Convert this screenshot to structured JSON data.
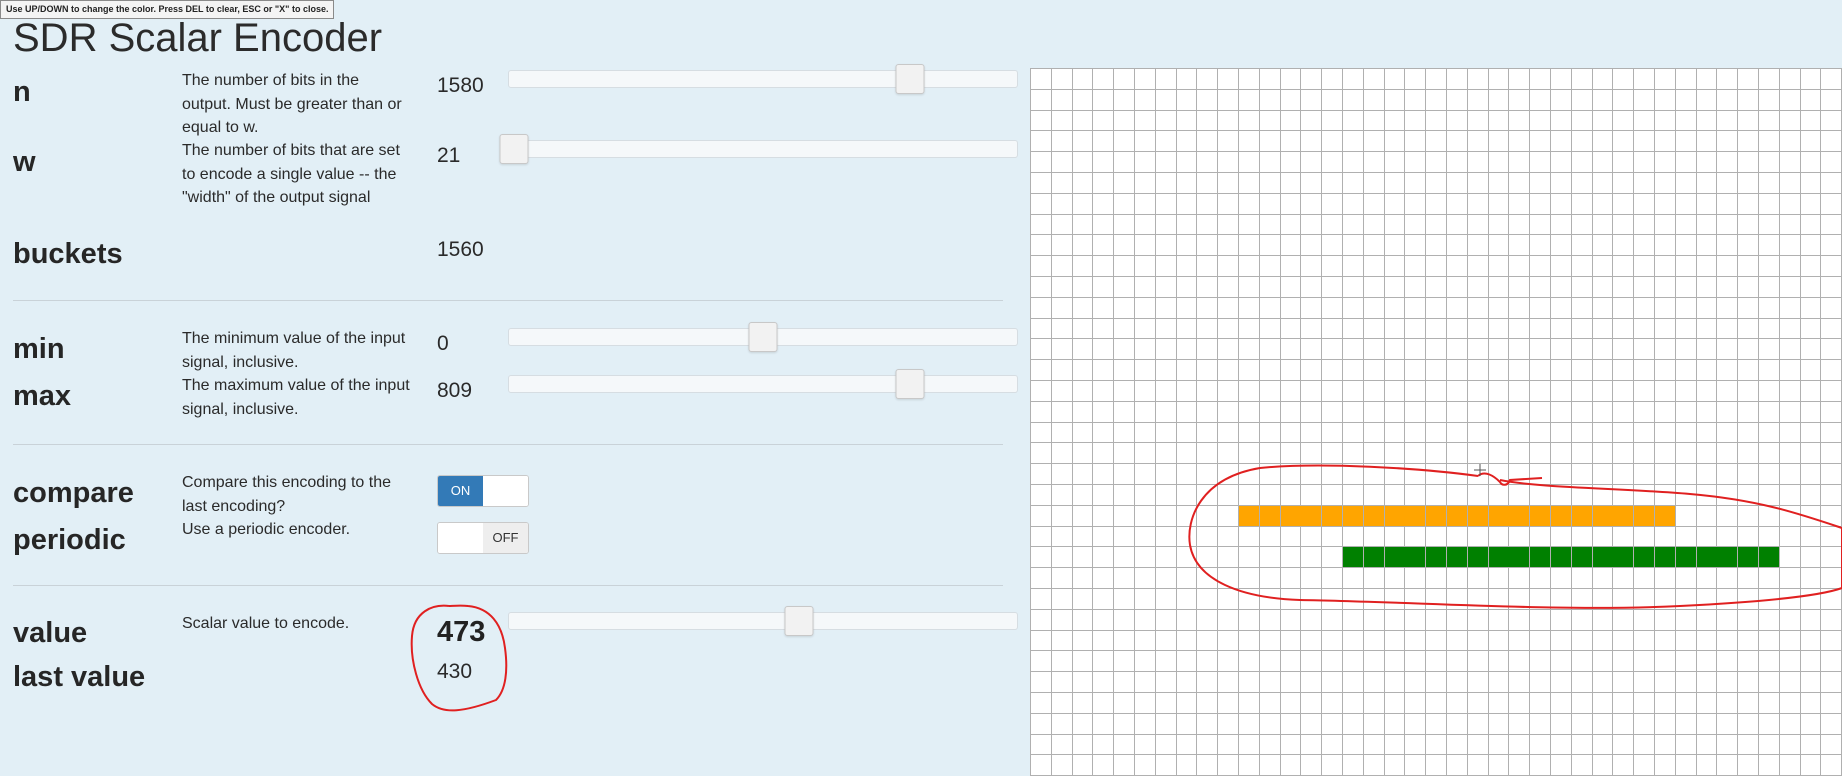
{
  "hint": "Use UP/DOWN to change the color. Press DEL to clear, ESC or \"X\" to close.",
  "title": "SDR Scalar Encoder",
  "params": {
    "n": {
      "label": "n",
      "desc": "The number of bits in the output. Must be greater than or equal to w.",
      "value": "1580",
      "slider_fraction": 0.79
    },
    "w": {
      "label": "w",
      "desc": "The number of bits that are set to encode a single value -- the \"width\" of the output signal",
      "value": "21",
      "slider_fraction": 0.01
    },
    "buckets": {
      "label": "buckets",
      "value": "1560"
    },
    "min": {
      "label": "min",
      "desc": "The minimum value of the input signal, inclusive.",
      "value": "0",
      "slider_fraction": 0.5
    },
    "max": {
      "label": "max",
      "desc": "The maximum value of the input signal, inclusive.",
      "value": "809",
      "slider_fraction": 0.79
    },
    "compare": {
      "label": "compare",
      "desc": "Compare this encoding to the last encoding?",
      "state": "ON"
    },
    "periodic": {
      "label": "periodic",
      "desc": "Use a periodic encoder.",
      "state": "OFF"
    },
    "value": {
      "label": "value",
      "desc": "Scalar value to encode.",
      "value": "473",
      "slider_fraction": 0.57
    },
    "last_value": {
      "label": "last value",
      "value": "430"
    }
  },
  "grid": {
    "columns": 40,
    "rows": 40,
    "last_color": "#ffa500",
    "current_color": "#008000",
    "last_row": 21,
    "last_start_col": 10,
    "current_row": 23,
    "current_start_col": 15,
    "active_bits": 21
  },
  "annotation_color": "#e02020"
}
